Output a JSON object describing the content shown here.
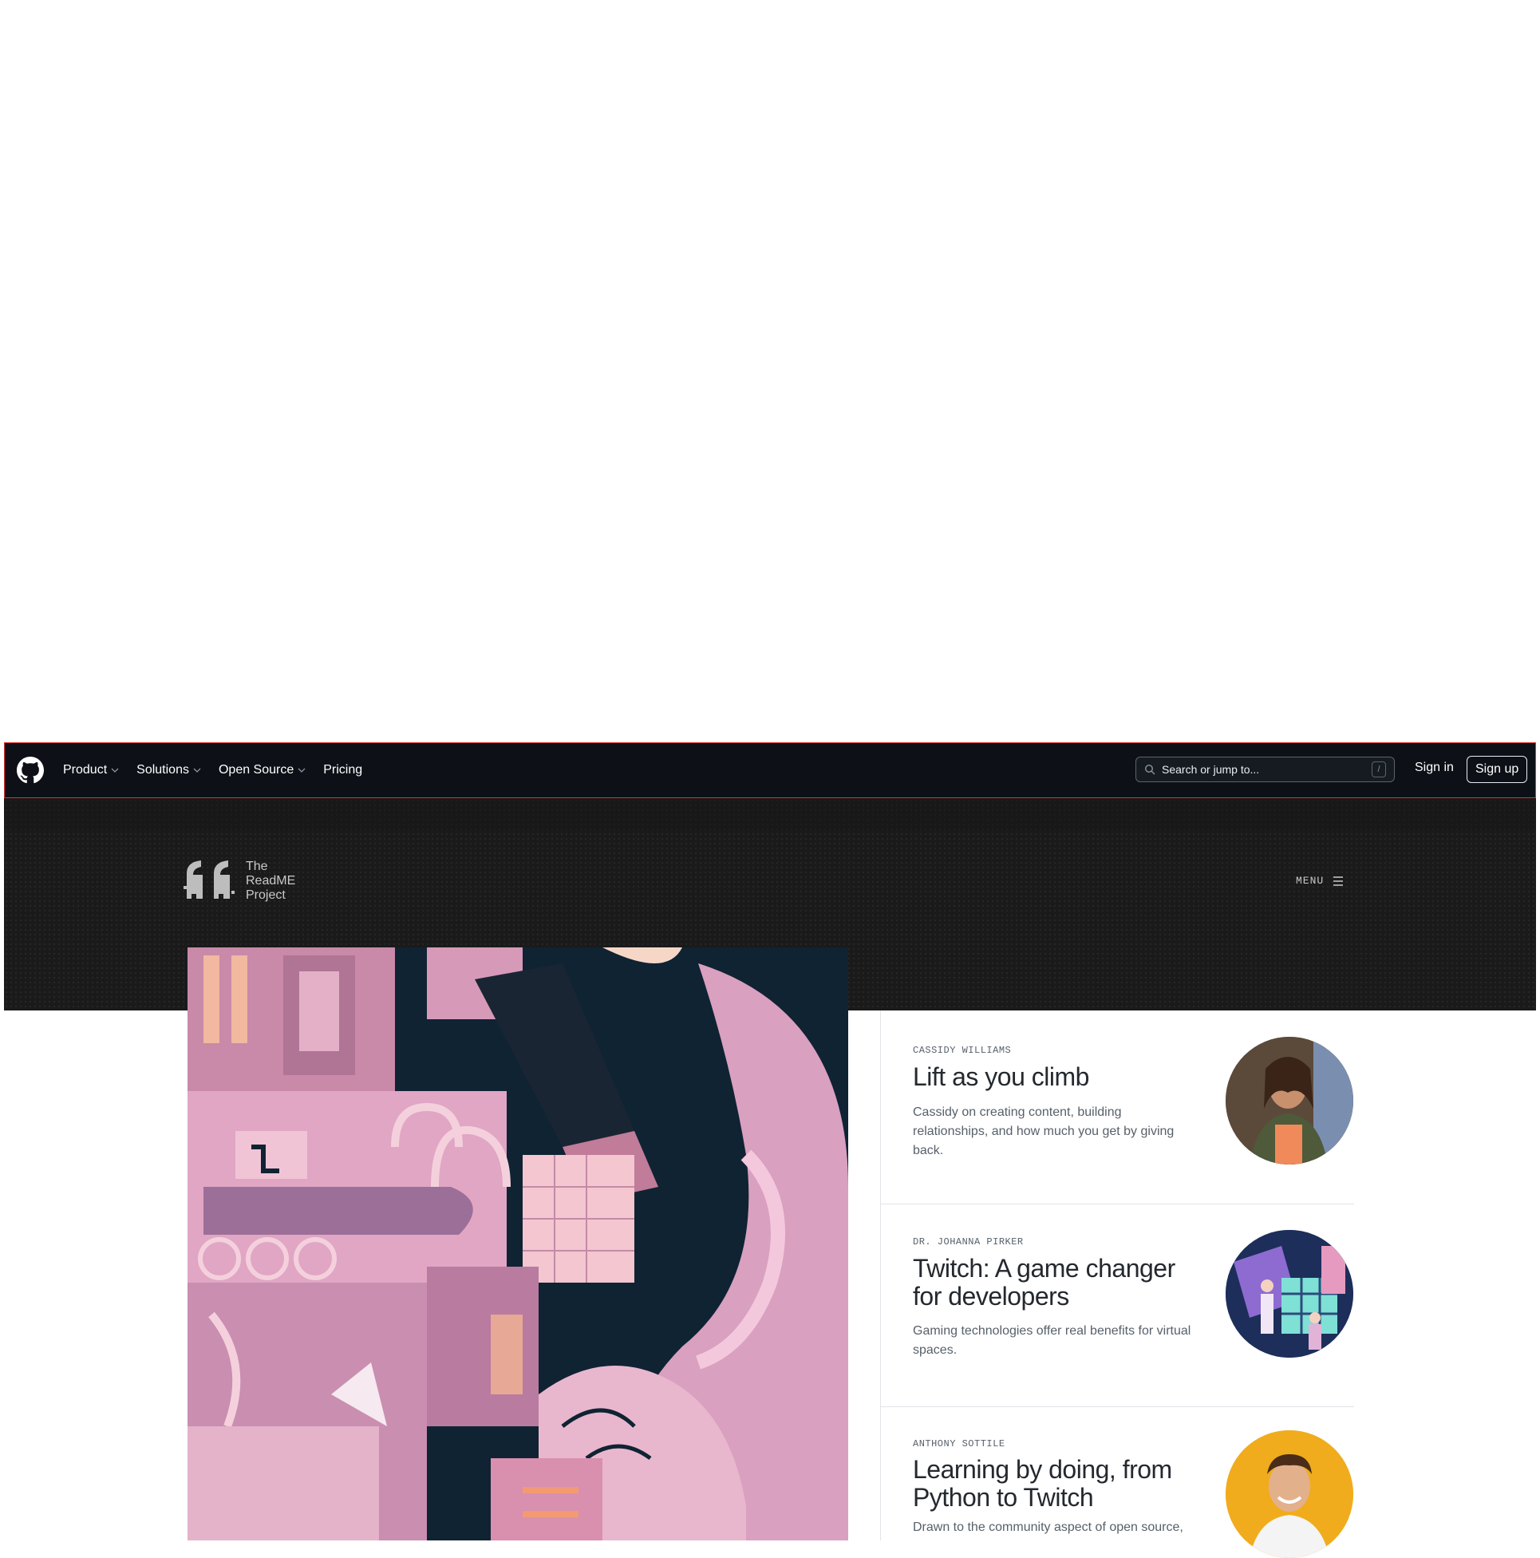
{
  "nav": {
    "items": [
      {
        "label": "Product",
        "dropdown": true
      },
      {
        "label": "Solutions",
        "dropdown": true
      },
      {
        "label": "Open Source",
        "dropdown": true
      },
      {
        "label": "Pricing",
        "dropdown": false
      }
    ],
    "search_placeholder": "Search or jump to...",
    "search_shortcut": "/",
    "sign_in": "Sign in",
    "sign_up": "Sign up"
  },
  "readme": {
    "logo_lines": [
      "The",
      "ReadME",
      "Project"
    ],
    "menu_label": "MENU"
  },
  "articles": [
    {
      "author": "CASSIDY WILLIAMS",
      "title": "Lift as you climb",
      "description": "Cassidy on creating content, building relationships, and how much you get by giving back."
    },
    {
      "author": "DR. JOHANNA PIRKER",
      "title": "Twitch: A game changer for developers",
      "description": "Gaming technologies offer real benefits for virtual spaces."
    },
    {
      "author": "ANTHONY SOTTILE",
      "title": "Learning by doing, from Python to Twitch",
      "description": "Drawn to the community aspect of open source,"
    }
  ],
  "colors": {
    "nav_bg": "#0d1117",
    "band_bg": "#1a1a1a",
    "hero_dark": "#0f2333",
    "hero_pink": "#d9a0c0"
  }
}
